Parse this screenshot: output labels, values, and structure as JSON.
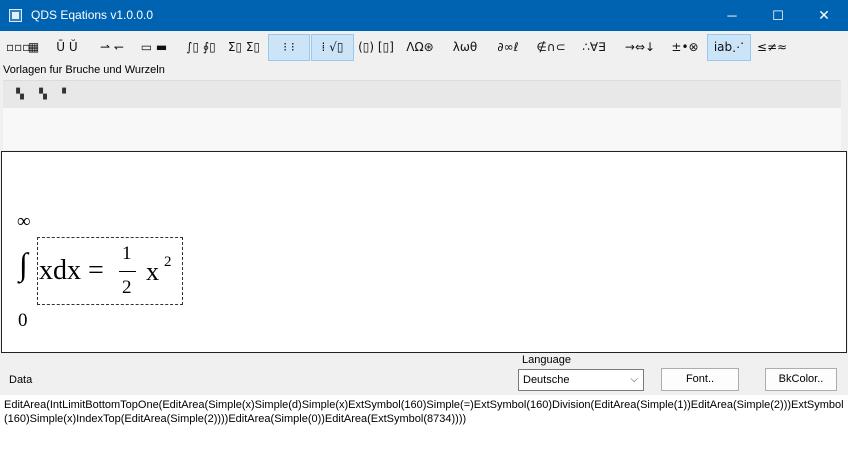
{
  "window": {
    "title": "QDS Eqations v1.0.0.0",
    "minimize_glyph": "─",
    "maximize_glyph": "☐",
    "close_glyph": "✕"
  },
  "toolbar": {
    "active_bg": "#cce4f7",
    "buttons": [
      {
        "name": "matrix-row-button",
        "glyph": "▫▫▫",
        "active": false
      },
      {
        "name": "matrix-grid-button",
        "glyph": "▦",
        "active": false
      },
      {
        "name": "over-under-button",
        "glyph": "Ū Ŭ",
        "active": false
      },
      {
        "name": "arrow-label-button",
        "glyph": "⇀ ↽",
        "active": false
      },
      {
        "name": "box-frame-button",
        "glyph": "▭ ▬",
        "active": false
      },
      {
        "name": "integral-button",
        "glyph": "∫▯ ∮▯",
        "active": false
      },
      {
        "name": "sum-button",
        "glyph": "Σ▯ Σ▯",
        "active": false
      },
      {
        "name": "fraction-button",
        "glyph": "⁝ ⁝",
        "active": true
      },
      {
        "name": "root-button",
        "glyph": "⁞ √▯",
        "active": true
      },
      {
        "name": "brackets-button",
        "glyph": "(▯) [▯]",
        "active": false
      },
      {
        "name": "greek-upper-button",
        "glyph": "ΛΩ⊛",
        "active": false
      },
      {
        "name": "greek-lower-button",
        "glyph": "λωθ",
        "active": false
      },
      {
        "name": "misc-symbols-button",
        "glyph": "∂∞ℓ",
        "active": false
      },
      {
        "name": "set-symbols-button",
        "glyph": "∉∩⊂",
        "active": false
      },
      {
        "name": "logic-symbols-button",
        "glyph": "∴∀∃",
        "active": false
      },
      {
        "name": "arrows-button",
        "glyph": "→⇔↓",
        "active": false
      },
      {
        "name": "operators-button",
        "glyph": "±•⊗",
        "active": false
      },
      {
        "name": "spacing-button",
        "glyph": "ⅰab⋰",
        "active": true
      },
      {
        "name": "relations-button",
        "glyph": "≤≠≈",
        "active": false
      }
    ]
  },
  "templates": {
    "label": "Vorlagen fur Bruche und Wurzeln",
    "buttons": [
      "▚",
      "▚",
      "▘"
    ]
  },
  "equation": {
    "upper_limit": "∞",
    "integral": "∫",
    "lower_limit": "0",
    "lhs": "xdx =",
    "numerator": "1",
    "denominator": "2",
    "base": "x",
    "exponent": "2"
  },
  "bottom": {
    "data_label": "Data",
    "language_label": "Language",
    "language_value": "Deutsche",
    "font_button": "Font..",
    "bkcolor_button": "BkColor..",
    "data_text": "EditArea(IntLimitBottomTopOne(EditArea(Simple(x)Simple(d)Simple(x)ExtSymbol(160)Simple(=)ExtSymbol(160)Division(EditArea(Simple(1))EditArea(Simple(2)))ExtSymbol(160)Simple(x)IndexTop(EditArea(Simple(2))))EditArea(Simple(0))EditArea(ExtSymbol(8734))))"
  }
}
